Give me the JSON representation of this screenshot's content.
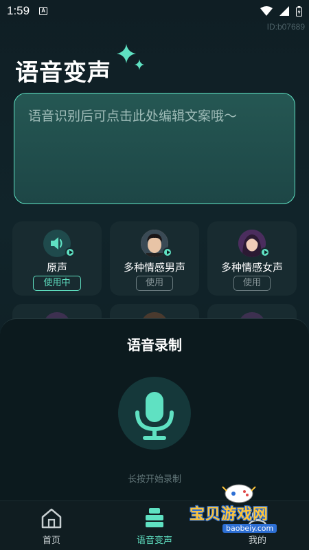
{
  "status_bar": {
    "time": "1:59",
    "notif_glyph": "A"
  },
  "id_label": "ID:b07689",
  "title": "语音变声",
  "text_box": {
    "placeholder": "语音识别后可点击此处编辑文案哦～"
  },
  "voices": [
    {
      "name": "原声",
      "button": "使用中",
      "active": true,
      "icon": "speaker-icon"
    },
    {
      "name": "多种情感男声",
      "button": "使用",
      "active": false,
      "icon": "male-avatar"
    },
    {
      "name": "多种情感女声",
      "button": "使用",
      "active": false,
      "icon": "female-avatar"
    }
  ],
  "sheet": {
    "title": "语音录制",
    "hint": "长按开始录制"
  },
  "nav": [
    {
      "label": "首页",
      "icon": "home-icon"
    },
    {
      "label": "语音变声",
      "icon": "voice-change-icon",
      "active": true
    },
    {
      "label": "我的",
      "icon": "profile-icon"
    }
  ],
  "watermark": {
    "text": "宝贝游戏网",
    "url": "baobeiy.com"
  },
  "colors": {
    "accent": "#5fe1c2",
    "background": "#0f1e24",
    "card": "#182b30",
    "watermark": "#ffc53a"
  }
}
